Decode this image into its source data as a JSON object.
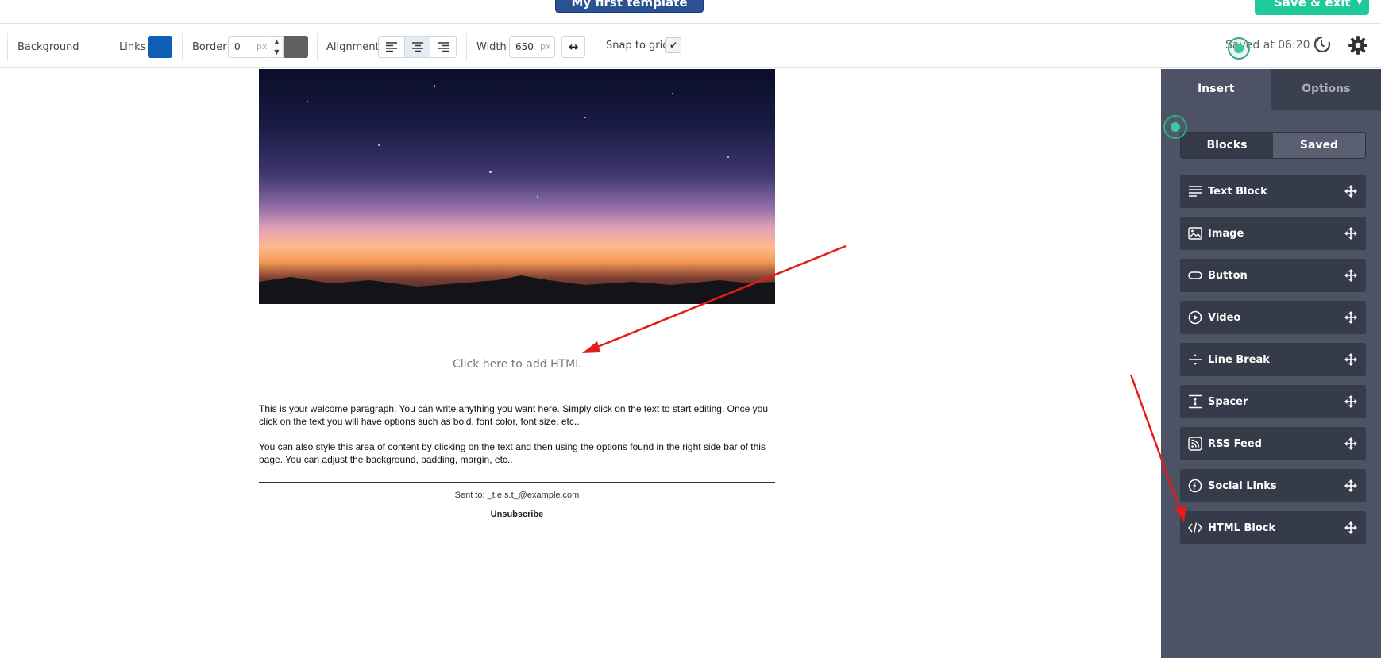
{
  "header": {
    "template_name": "My first template",
    "save_exit_label": "Save & exit"
  },
  "toolbar": {
    "background_label": "Background",
    "links_label": "Links",
    "links_color": "#0d5fb6",
    "border_label": "Border",
    "border_value": "0",
    "border_unit": "px",
    "border_color": "#5f6062",
    "alignment_label": "Alignment",
    "alignment_selected": "center",
    "width_label": "Width",
    "width_value": "650",
    "width_unit": "px",
    "snap_label": "Snap to grid",
    "snap_checked": true,
    "saved_at": "Saved at 06:20"
  },
  "email": {
    "html_placeholder": "Click here to add HTML",
    "paragraph_1": "This is your welcome paragraph. You can write anything you want here. Simply click on the text to start editing. Once you click on the text you will have options such as bold, font color, font size, etc..",
    "paragraph_2": "You can also style this area of content by clicking on the text and then using the options found in the right side bar of this page. You can adjust the background, padding, margin, etc..",
    "sent_to": "Sent to: _t.e.s.t_@example.com",
    "unsubscribe": "Unsubscribe"
  },
  "panel": {
    "tabs": [
      {
        "label": "Insert",
        "active": true
      },
      {
        "label": "Options",
        "active": false
      }
    ],
    "segments": [
      {
        "label": "Blocks",
        "active": true
      },
      {
        "label": "Saved",
        "active": false
      }
    ],
    "blocks": [
      {
        "label": "Text Block",
        "icon": "text-lines-icon"
      },
      {
        "label": "Image",
        "icon": "image-icon"
      },
      {
        "label": "Button",
        "icon": "button-pill-icon"
      },
      {
        "label": "Video",
        "icon": "play-circle-icon"
      },
      {
        "label": "Line Break",
        "icon": "line-break-icon"
      },
      {
        "label": "Spacer",
        "icon": "spacer-icon"
      },
      {
        "label": "RSS Feed",
        "icon": "rss-icon"
      },
      {
        "label": "Social Links",
        "icon": "facebook-circle-icon"
      },
      {
        "label": "HTML Block",
        "icon": "code-icon"
      }
    ]
  },
  "colors": {
    "accent_green": "#1fc99a",
    "panel_bg": "#4d5364",
    "item_bg": "#363b4a",
    "arrow": "#e41c1c"
  }
}
